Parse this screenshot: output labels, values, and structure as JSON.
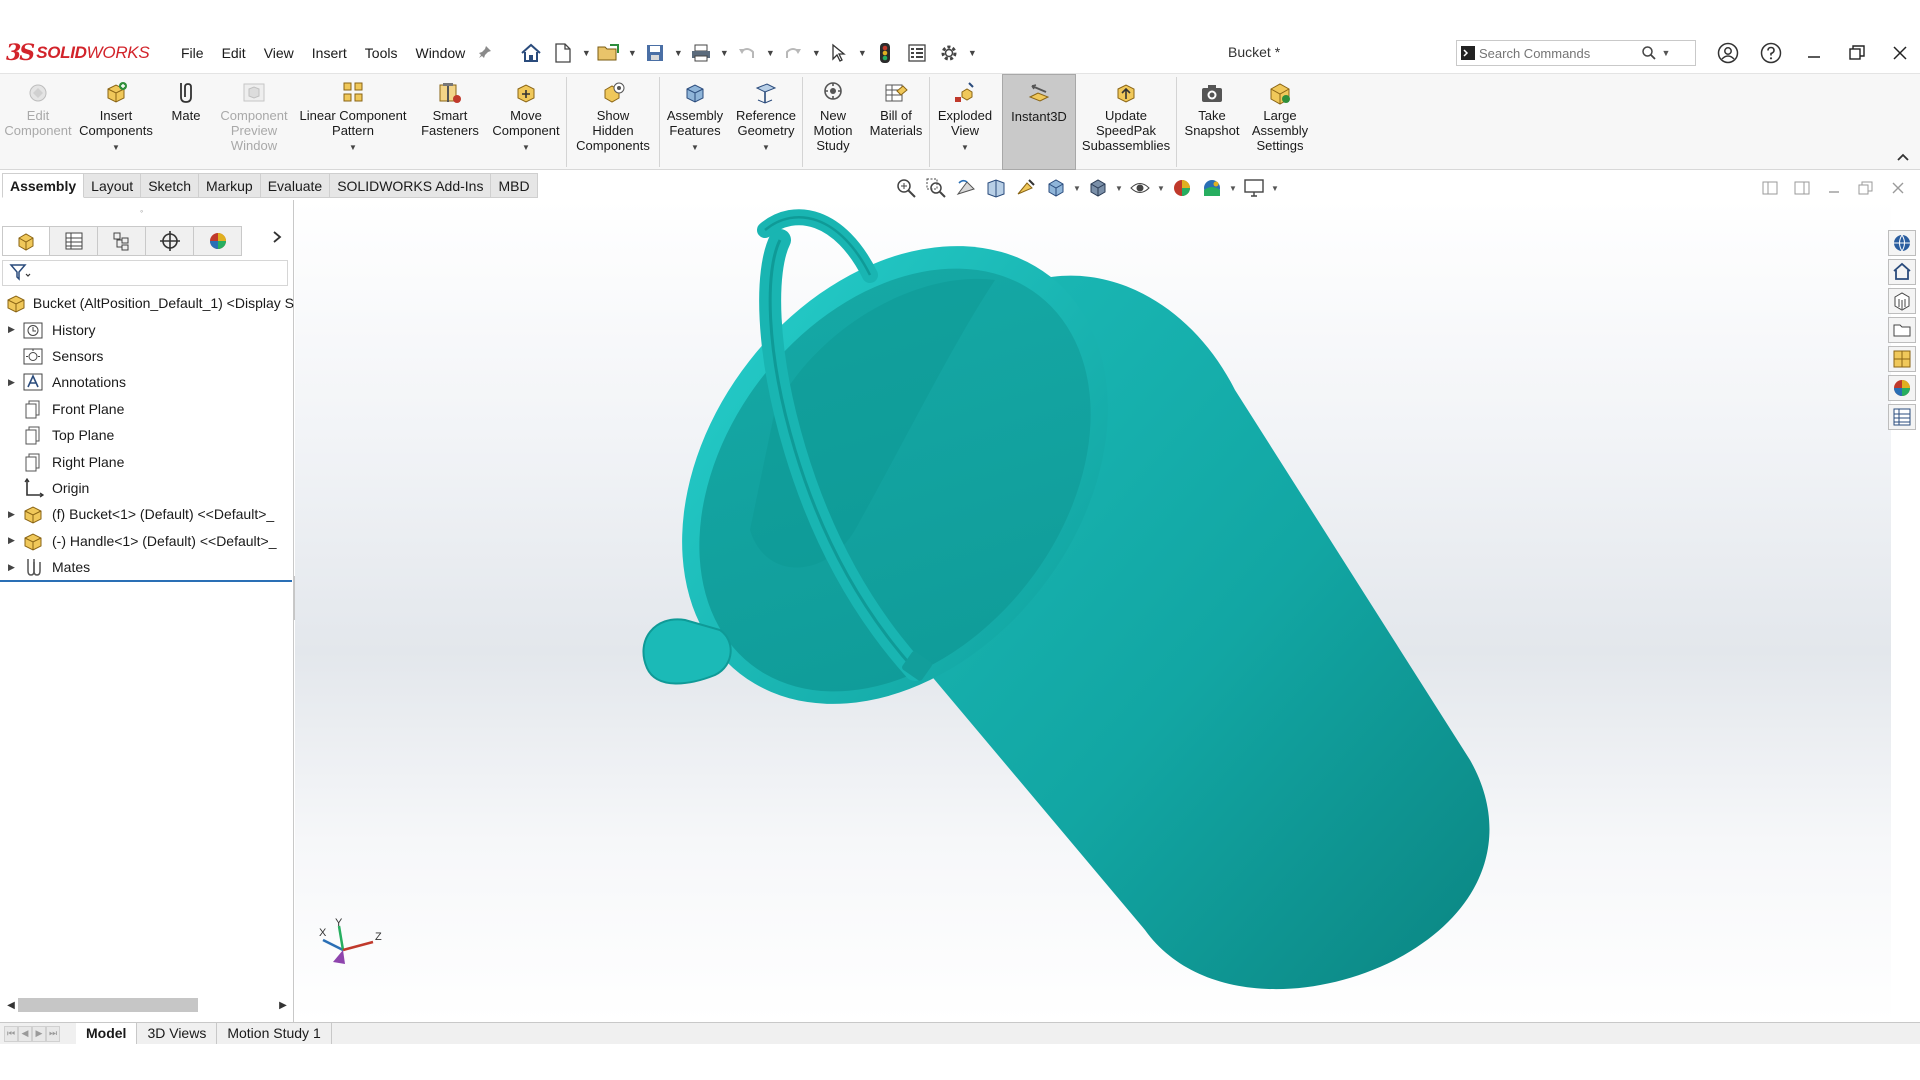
{
  "app": {
    "brand_mark": "3S",
    "brand_bold": "SOLID",
    "brand_light": "WORKS",
    "document_title": "Bucket *"
  },
  "menu": [
    "File",
    "Edit",
    "View",
    "Insert",
    "Tools",
    "Window"
  ],
  "search": {
    "placeholder": "Search Commands"
  },
  "ribbon": {
    "buttons": [
      {
        "label_lines": [
          "Edit",
          "Component"
        ],
        "icon": "edit-component-icon",
        "enabled": false
      },
      {
        "label_lines": [
          "Insert",
          "Components"
        ],
        "icon": "insert-components-icon",
        "enabled": true,
        "has_dropdown": true
      },
      {
        "label_lines": [
          "Mate"
        ],
        "icon": "mate-icon",
        "enabled": true
      },
      {
        "label_lines": [
          "Component",
          "Preview",
          "Window"
        ],
        "icon": "component-preview-icon",
        "enabled": false
      },
      {
        "label_lines": [
          "Linear Component",
          "Pattern"
        ],
        "icon": "linear-pattern-icon",
        "enabled": true,
        "has_dropdown": true
      },
      {
        "label_lines": [
          "Smart",
          "Fasteners"
        ],
        "icon": "smart-fasteners-icon",
        "enabled": true
      },
      {
        "label_lines": [
          "Move",
          "Component"
        ],
        "icon": "move-component-icon",
        "enabled": true,
        "has_dropdown": true
      },
      {
        "label_lines": [
          "Show",
          "Hidden",
          "Components"
        ],
        "icon": "show-hidden-icon",
        "enabled": true
      },
      {
        "label_lines": [
          "Assembly",
          "Features"
        ],
        "icon": "assembly-features-icon",
        "enabled": true,
        "has_dropdown": true
      },
      {
        "label_lines": [
          "Reference",
          "Geometry"
        ],
        "icon": "reference-geometry-icon",
        "enabled": true,
        "has_dropdown": true
      },
      {
        "label_lines": [
          "New",
          "Motion",
          "Study"
        ],
        "icon": "motion-study-icon",
        "enabled": true
      },
      {
        "label_lines": [
          "Bill of",
          "Materials"
        ],
        "icon": "bill-of-materials-icon",
        "enabled": true
      },
      {
        "label_lines": [
          "Exploded",
          "View"
        ],
        "icon": "exploded-view-icon",
        "enabled": true,
        "has_dropdown": true
      },
      {
        "label_lines": [
          "Instant3D"
        ],
        "icon": "instant3d-icon",
        "enabled": true,
        "active": true
      },
      {
        "label_lines": [
          "Update",
          "SpeedPak",
          "Subassemblies"
        ],
        "icon": "speedpak-icon",
        "enabled": true
      },
      {
        "label_lines": [
          "Take",
          "Snapshot"
        ],
        "icon": "camera-icon",
        "enabled": true
      },
      {
        "label_lines": [
          "Large",
          "Assembly",
          "Settings"
        ],
        "icon": "large-assembly-icon",
        "enabled": true
      }
    ]
  },
  "command_tabs": [
    "Assembly",
    "Layout",
    "Sketch",
    "Markup",
    "Evaluate",
    "SOLIDWORKS Add-Ins",
    "MBD"
  ],
  "active_command_tab": "Assembly",
  "feature_tree": {
    "root": "Bucket (AltPosition_Default_1) <Display S",
    "items": [
      {
        "label": "History",
        "icon": "history-folder-icon",
        "expandable": true
      },
      {
        "label": "Sensors",
        "icon": "sensors-folder-icon",
        "expandable": false
      },
      {
        "label": "Annotations",
        "icon": "annotations-icon",
        "expandable": true
      },
      {
        "label": "Front Plane",
        "icon": "plane-icon",
        "expandable": false
      },
      {
        "label": "Top Plane",
        "icon": "plane-icon",
        "expandable": false
      },
      {
        "label": "Right Plane",
        "icon": "plane-icon",
        "expandable": false
      },
      {
        "label": "Origin",
        "icon": "origin-icon",
        "expandable": false
      },
      {
        "label": "(f) Bucket<1> (Default) <<Default>_",
        "icon": "part-icon",
        "expandable": true
      },
      {
        "label": "(-) Handle<1> (Default) <<Default>_",
        "icon": "part-icon",
        "expandable": true
      },
      {
        "label": "Mates",
        "icon": "mates-icon",
        "expandable": true
      }
    ]
  },
  "bottom_tabs": [
    "Model",
    "3D Views",
    "Motion Study 1"
  ],
  "active_bottom_tab": "Model",
  "triad_labels": {
    "x": "X",
    "y": "Y",
    "z": "Z"
  },
  "colors": {
    "brand_red": "#d2232a",
    "model_teal": "#17b3b0",
    "active_blue": "#2a6fb5"
  }
}
